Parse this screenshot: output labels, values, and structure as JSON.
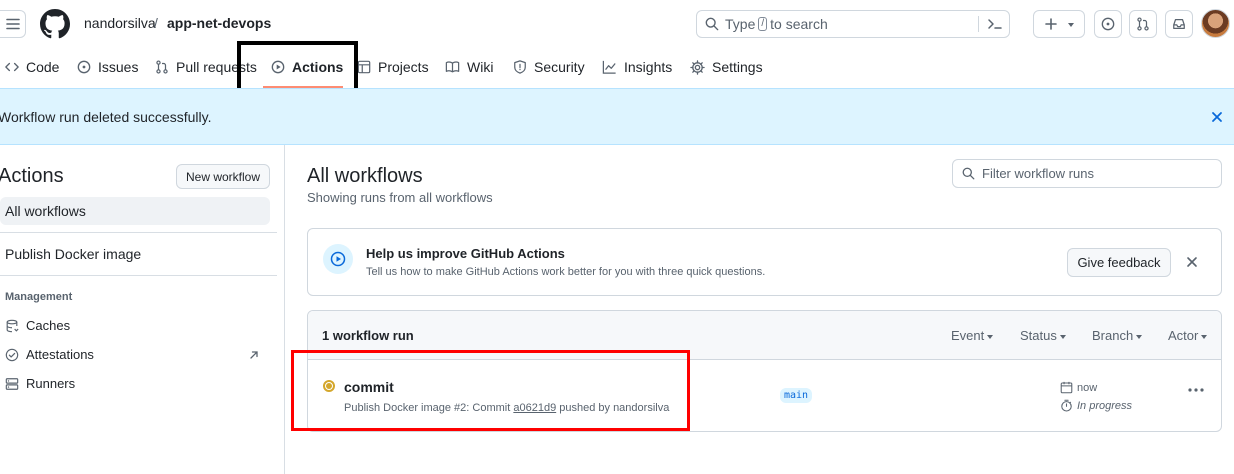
{
  "header": {
    "owner": "nandorsilva",
    "separator": "/",
    "repo": "app-net-devops",
    "search_prefix": "Type",
    "search_key": "/",
    "search_suffix": "to search"
  },
  "tabs": [
    {
      "label": "Code"
    },
    {
      "label": "Issues"
    },
    {
      "label": "Pull requests"
    },
    {
      "label": "Actions"
    },
    {
      "label": "Projects"
    },
    {
      "label": "Wiki"
    },
    {
      "label": "Security"
    },
    {
      "label": "Insights"
    },
    {
      "label": "Settings"
    }
  ],
  "flash": {
    "message": "Workflow run deleted successfully."
  },
  "sidebar": {
    "title": "Actions",
    "new_workflow": "New workflow",
    "all_workflows": "All workflows",
    "workflow": "Publish Docker image",
    "management_label": "Management",
    "links": [
      {
        "label": "Caches"
      },
      {
        "label": "Attestations"
      },
      {
        "label": "Runners"
      }
    ]
  },
  "main": {
    "title": "All workflows",
    "subtitle": "Showing runs from all workflows",
    "filter_placeholder": "Filter workflow runs",
    "banner": {
      "title": "Help us improve GitHub Actions",
      "subtitle": "Tell us how to make GitHub Actions work better for you with three quick questions.",
      "button": "Give feedback"
    },
    "runs": {
      "count": "1 workflow run",
      "filters": [
        "Event",
        "Status",
        "Branch",
        "Actor"
      ],
      "items": [
        {
          "title": "commit",
          "sub_prefix": "Publish Docker image #2: Commit",
          "sha": "a0621d9",
          "sub_suffix": "pushed by nandorsilva",
          "branch": "main",
          "time": "now",
          "status": "In progress",
          "status_color": "#d4a72c"
        }
      ]
    }
  },
  "colors": {
    "accent_underline": "#fd8c73",
    "flash_bg": "#ddf4ff",
    "annotation_black": "#000000",
    "annotation_red": "#ff0000"
  }
}
